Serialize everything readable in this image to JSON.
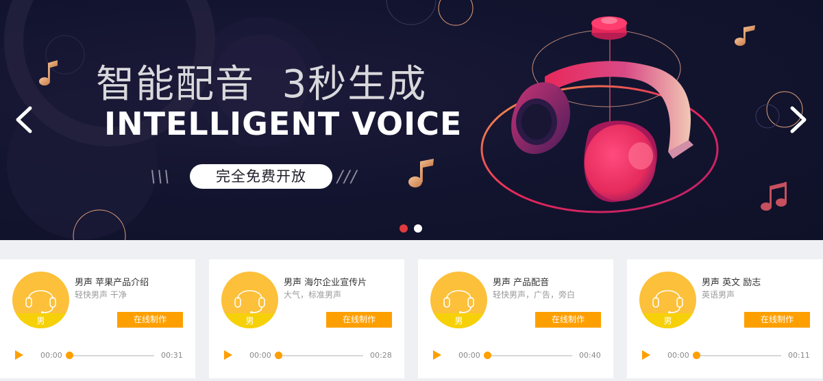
{
  "banner": {
    "headline_cn": "智能配音",
    "headline_rest": "3秒生成",
    "subline": "INTELLIGENT VOICE",
    "pill": "完全免费开放",
    "slashes_left": "\\\\\\",
    "slashes_right": "///",
    "arrows": {
      "prev_icon": "chevron-left-icon",
      "next_icon": "chevron-right-icon"
    },
    "carousel": {
      "count": 2,
      "active": 0
    },
    "colors": {
      "background": "#131530",
      "accent_pink": "#e8285a",
      "accent_orange": "#f09a55",
      "dot_active": "#e03a3f"
    }
  },
  "cards": [
    {
      "title": "男声 苹果产品介绍",
      "desc": "轻快男声 干净",
      "gender": "男",
      "button": "在线制作",
      "current": "00:00",
      "total": "00:31"
    },
    {
      "title": "男声 海尔企业宣传片",
      "desc": "大气，标准男声",
      "gender": "男",
      "button": "在线制作",
      "current": "00:00",
      "total": "00:28"
    },
    {
      "title": "男声 产品配音",
      "desc": "轻快男声，广告，旁白",
      "gender": "男",
      "button": "在线制作",
      "current": "00:00",
      "total": "00:40"
    },
    {
      "title": "男声 英文 励志",
      "desc": "英语男声",
      "gender": "男",
      "button": "在线制作",
      "current": "00:00",
      "total": "00:11"
    }
  ],
  "card_colors": {
    "avatar": "#fcc03a",
    "band": "#f6d10a",
    "button": "#fe9f00"
  },
  "icons": {
    "avatar_icon": "headset-icon",
    "play_icon": "play-icon",
    "note_icon": "music-note-icon"
  }
}
